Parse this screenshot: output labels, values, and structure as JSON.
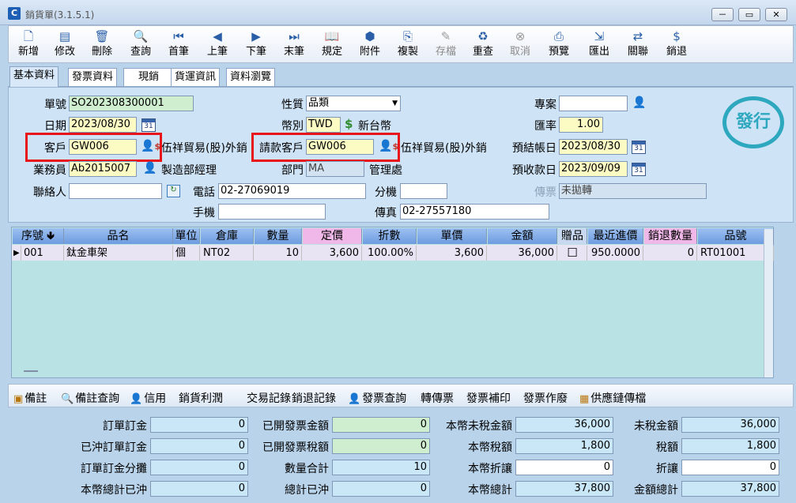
{
  "window": {
    "icon_letter": "C",
    "title": "銷貨單(3.1.5.1)",
    "controls": [
      "－",
      "▭",
      "✕"
    ]
  },
  "toolbar": [
    {
      "label": "新增",
      "icon": "new-doc-icon",
      "glyph": "🗋",
      "enabled": true
    },
    {
      "label": "修改",
      "icon": "edit-icon",
      "glyph": "▤",
      "enabled": true
    },
    {
      "label": "刪除",
      "icon": "trash-icon",
      "glyph": "🗑",
      "enabled": true
    },
    {
      "label": "查詢",
      "icon": "search-icon",
      "glyph": "🔍",
      "enabled": true
    },
    {
      "label": "首筆",
      "icon": "first-icon",
      "glyph": "⏮",
      "enabled": true
    },
    {
      "label": "上筆",
      "icon": "prev-icon",
      "glyph": "◀",
      "enabled": true
    },
    {
      "label": "下筆",
      "icon": "next-icon",
      "glyph": "▶",
      "enabled": true
    },
    {
      "label": "末筆",
      "icon": "last-icon",
      "glyph": "⏭",
      "enabled": true
    },
    {
      "label": "規定",
      "icon": "book-icon",
      "glyph": "📖",
      "enabled": true
    },
    {
      "label": "附件",
      "icon": "attachment-icon",
      "glyph": "⬢",
      "enabled": true
    },
    {
      "label": "複製",
      "icon": "copy-icon",
      "glyph": "⎘",
      "enabled": true
    },
    {
      "label": "存檔",
      "icon": "save-icon",
      "glyph": "✎",
      "enabled": false
    },
    {
      "label": "重查",
      "icon": "refresh-icon",
      "glyph": "♻",
      "enabled": true
    },
    {
      "label": "取消",
      "icon": "cancel-icon",
      "glyph": "⊗",
      "enabled": false
    },
    {
      "label": "預覽",
      "icon": "preview-icon",
      "glyph": "⎙",
      "enabled": true
    },
    {
      "label": "匯出",
      "icon": "export-icon",
      "glyph": "⇲",
      "enabled": true
    },
    {
      "label": "關聯",
      "icon": "relation-icon",
      "glyph": "⇄",
      "enabled": true
    },
    {
      "label": "銷退",
      "icon": "return-icon",
      "glyph": "$",
      "enabled": true
    }
  ],
  "tabs": [
    "基本資料",
    "發票資料",
    "現銷",
    "貨運資訊",
    "資料瀏覽"
  ],
  "form": {
    "order_no_label": "單號",
    "order_no": "SO202308300001",
    "date_label": "日期",
    "date": "2023/08/30",
    "customer_label": "客戶",
    "customer": "GW006",
    "customer_name": "伍祥貿易(股)外銷",
    "salesperson_label": "業務員",
    "salesperson": "Ab2015007",
    "salesperson_title": "製造部經理",
    "contact_label": "聯絡人",
    "contact": "",
    "nature_label": "性質",
    "nature": "品類",
    "currency_label": "幣別",
    "currency": "TWD",
    "currency_name": "新台幣",
    "bill_customer_label": "請款客戶",
    "bill_customer": "GW006",
    "bill_customer_name": "伍祥貿易(股)外銷",
    "dept_label": "部門",
    "dept": "MA",
    "dept_name": "管理處",
    "phone_label": "電話",
    "phone": "02-27069019",
    "ext_label": "分機",
    "ext": "",
    "mobile_label": "手機",
    "mobile": "",
    "fax_label": "傳真",
    "fax": "02-27557180",
    "project_label": "專案",
    "project": "",
    "rate_label": "匯率",
    "rate": "1.00",
    "account_date_label": "預結帳日",
    "account_date": "2023/08/30",
    "collect_date_label": "預收款日",
    "collect_date": "2023/09/09",
    "voucher_label": "傳票",
    "voucher": "未拋轉",
    "calendar_glyph": "31",
    "stamp": "發行"
  },
  "grid": {
    "columns": [
      "序號",
      "品名",
      "單位",
      "倉庫",
      "數量",
      "定價",
      "折數",
      "單價",
      "金額",
      "贈品",
      "最近進價",
      "銷退數量",
      "品號"
    ],
    "sort_glyph": "🢃",
    "row_marker": "▶",
    "rows": [
      {
        "seq": "001",
        "name": "鈦金車架",
        "unit": "個",
        "warehouse": "NT02",
        "qty": "10",
        "list_price": "3,600",
        "discount": "100.00%",
        "unit_price": "3,600",
        "amount": "36,000",
        "gift": "☐",
        "last_cost": "950.0000",
        "return_qty": "0",
        "item_no": "RT01001"
      }
    ]
  },
  "links": [
    {
      "label": "備註",
      "icon": "note-icon",
      "glyph": "▣"
    },
    {
      "label": "備註查詢",
      "icon": "search-icon",
      "glyph": "🔍"
    },
    {
      "label": "信用",
      "icon": "person-icon",
      "glyph": "👤"
    },
    {
      "label": "銷貨利潤",
      "icon": "",
      "glyph": ""
    },
    {
      "label": "交易記錄",
      "icon": "",
      "glyph": ""
    },
    {
      "label": "銷退記錄",
      "icon": "",
      "glyph": ""
    },
    {
      "label": "發票查詢",
      "icon": "person-icon",
      "glyph": "👤"
    },
    {
      "label": "轉傳票",
      "icon": "",
      "glyph": ""
    },
    {
      "label": "發票補印",
      "icon": "",
      "glyph": ""
    },
    {
      "label": "發票作廢",
      "icon": "",
      "glyph": ""
    },
    {
      "label": "供應鏈傳檔",
      "icon": "calendar-icon",
      "glyph": "▦"
    }
  ],
  "totals": {
    "order_deposit_label": "訂單訂金",
    "order_deposit": "0",
    "offset_deposit_label": "已沖訂單訂金",
    "offset_deposit": "0",
    "deposit_alloc_label": "訂單訂金分攤",
    "deposit_alloc": "0",
    "local_total_offset_label": "本幣總計已沖",
    "local_total_offset": "0",
    "invoiced_amount_label": "已開發票金額",
    "invoiced_amount": "0",
    "invoiced_tax_label": "已開發票稅額",
    "invoiced_tax": "0",
    "qty_total_label": "數量合計",
    "qty_total": "10",
    "total_offset_label": "總計已沖",
    "total_offset": "0",
    "local_pretax_label": "本幣未稅金額",
    "local_pretax": "36,000",
    "local_tax_label": "本幣稅額",
    "local_tax": "1,800",
    "local_discount_label": "本幣折讓",
    "local_discount": "0",
    "local_total_label": "本幣總計",
    "local_total": "37,800",
    "pretax_label": "未稅金額",
    "pretax": "36,000",
    "tax_label": "稅額",
    "tax": "1,800",
    "discount_label": "折讓",
    "discount": "0",
    "grand_total_label": "金額總計",
    "grand_total": "37,800"
  }
}
